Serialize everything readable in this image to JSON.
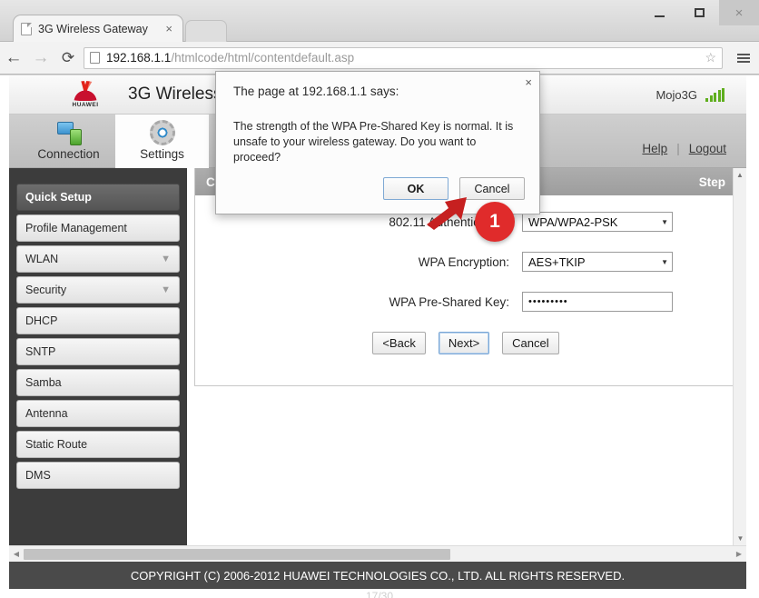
{
  "browser": {
    "tab": {
      "title": "3G Wireless Gateway",
      "close_label": "×"
    },
    "nav": {
      "back": "←",
      "forward": "→",
      "reload": "⟳"
    },
    "url": {
      "host": "192.168.1.1",
      "path": "/htmlcode/html/contentdefault.asp"
    },
    "star_icon": "☆",
    "window": {
      "minimize": "",
      "maximize": "",
      "close": "×"
    }
  },
  "router": {
    "brand": {
      "logo_text": "HUAWEI",
      "title": "3G Wireless"
    },
    "device_name": "Mojo3G",
    "tabs": [
      {
        "label": "Connection",
        "icon": "connection-icon",
        "active": false
      },
      {
        "label": "Settings",
        "icon": "gear-icon",
        "active": true
      }
    ],
    "links": {
      "help": "Help",
      "separator": "|",
      "logout": "Logout"
    },
    "sidebar": [
      {
        "label": "Quick Setup",
        "active": true,
        "expandable": false
      },
      {
        "label": "Profile Management",
        "active": false,
        "expandable": false
      },
      {
        "label": "WLAN",
        "active": false,
        "expandable": true
      },
      {
        "label": "Security",
        "active": false,
        "expandable": true
      },
      {
        "label": "DHCP",
        "active": false,
        "expandable": false
      },
      {
        "label": "SNTP",
        "active": false,
        "expandable": false
      },
      {
        "label": "Samba",
        "active": false,
        "expandable": false
      },
      {
        "label": "Antenna",
        "active": false,
        "expandable": false
      },
      {
        "label": "Static Route",
        "active": false,
        "expandable": false
      },
      {
        "label": "DMS",
        "active": false,
        "expandable": false
      }
    ],
    "card": {
      "header_left": "Con",
      "header_right": "Step",
      "fields": [
        {
          "label": "802.11 Authentication:",
          "value": "WPA/WPA2-PSK",
          "type": "select"
        },
        {
          "label": "WPA Encryption:",
          "value": "AES+TKIP",
          "type": "select"
        },
        {
          "label": "WPA Pre-Shared Key:",
          "value": "•••••••••",
          "type": "password"
        }
      ],
      "buttons": [
        {
          "label": "<Back",
          "focused": false
        },
        {
          "label": "Next>",
          "focused": true
        },
        {
          "label": "Cancel",
          "focused": false
        }
      ]
    },
    "footer": "COPYRIGHT (C) 2006-2012 HUAWEI TECHNOLOGIES CO., LTD. ALL RIGHTS RESERVED.",
    "page_number": "17/30"
  },
  "dialog": {
    "title": "The page at 192.168.1.1 says:",
    "message": "The strength of the WPA Pre-Shared Key is normal. It is unsafe to your wireless gateway. Do you want to proceed?",
    "close_label": "×",
    "ok_label": "OK",
    "cancel_label": "Cancel"
  },
  "callout": {
    "number": "1",
    "color": "#e02b2b"
  }
}
